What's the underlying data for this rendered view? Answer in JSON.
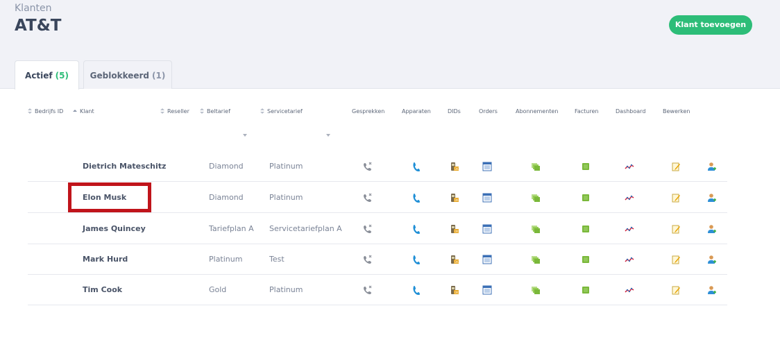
{
  "header": {
    "breadcrumb": "Klanten",
    "title": "AT&T",
    "add_button": "Klant toevoegen"
  },
  "tabs": [
    {
      "label": "Actief",
      "count": "(5)",
      "active": true
    },
    {
      "label": "Geblokkeerd",
      "count": "(1)",
      "active": false
    }
  ],
  "columns": {
    "bedrijfs_id": "Bedrijfs ID",
    "klant": "Klant",
    "reseller": "Reseller",
    "beltarief": "Beltarief",
    "servicetarief": "Servicetarief",
    "gesprekken": "Gesprekken",
    "apparaten": "Apparaten",
    "dids": "DIDs",
    "orders": "Orders",
    "abonnementen": "Abonnementen",
    "facturen": "Facturen",
    "dashboard": "Dashboard",
    "bewerken": "Bewerken"
  },
  "rows": [
    {
      "name": "Dietrich Mateschitz",
      "beltarief": "Diamond",
      "servicetarief": "Platinum"
    },
    {
      "name": "Elon Musk",
      "beltarief": "Diamond",
      "servicetarief": "Platinum"
    },
    {
      "name": "James Quincey",
      "beltarief": "Tariefplan A",
      "servicetarief": "Servicetariefplan A"
    },
    {
      "name": "Mark Hurd",
      "beltarief": "Platinum",
      "servicetarief": "Test"
    },
    {
      "name": "Tim Cook",
      "beltarief": "Gold",
      "servicetarief": "Platinum"
    }
  ],
  "row_icons": [
    "call-history-icon",
    "phone-icon",
    "did-icon",
    "orders-icon",
    "subscriptions-icon",
    "invoices-icon",
    "dashboard-icon",
    "edit-icon",
    "user-icon"
  ],
  "colors": {
    "accent": "#2dbd78",
    "highlight": "#c0141b"
  }
}
